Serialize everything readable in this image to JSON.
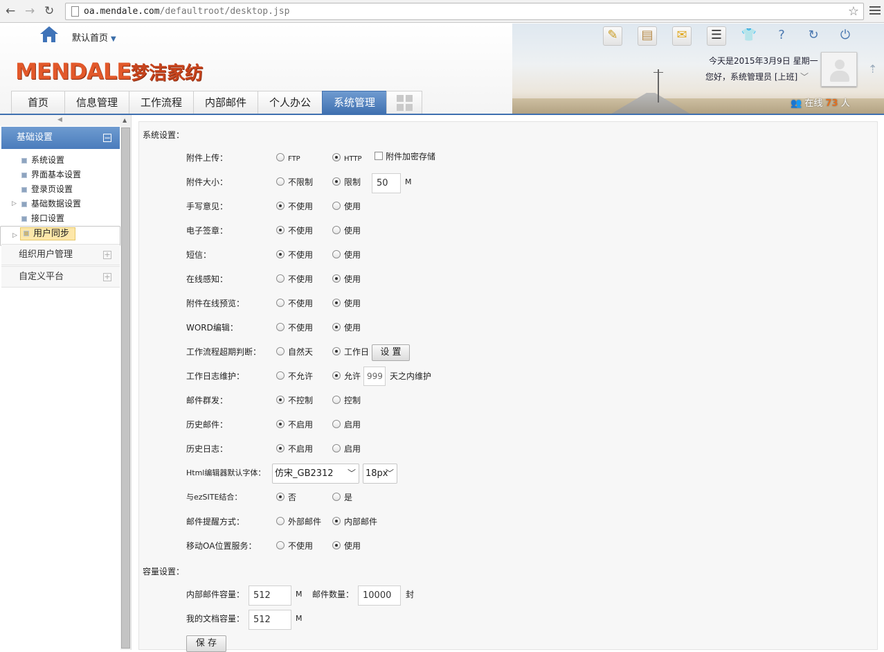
{
  "browser": {
    "url_domain": "oa.mendale.com",
    "url_path": "/defaultroot/desktop.jsp"
  },
  "header": {
    "home_label": "默认首页",
    "logo_text": "MENDALE",
    "logo_cn": "梦洁家纺",
    "date_text": "今天是2015年3月9日 星期一",
    "greeting": "您好，系统管理员 [上班]",
    "online_prefix": "在线",
    "online_count": "73",
    "online_suffix": "人",
    "toolbar_icons": [
      "edit-icon",
      "clipboard-icon",
      "mail-icon",
      "list-icon",
      "shirt-icon",
      "help-icon",
      "refresh-icon",
      "power-icon"
    ]
  },
  "tabs": [
    {
      "label": "首页"
    },
    {
      "label": "信息管理"
    },
    {
      "label": "工作流程"
    },
    {
      "label": "内部邮件"
    },
    {
      "label": "个人办公"
    },
    {
      "label": "系统管理",
      "active": true
    }
  ],
  "sidebar": {
    "section_active": "基础设置",
    "items": [
      {
        "label": "系统设置"
      },
      {
        "label": "界面基本设置"
      },
      {
        "label": "登录页设置"
      },
      {
        "label": "基础数据设置",
        "expandable": true
      },
      {
        "label": "接口设置"
      },
      {
        "label": "用户同步",
        "expandable": true,
        "selected": true
      }
    ],
    "sections": [
      {
        "label": "组织用户管理"
      },
      {
        "label": "自定义平台"
      }
    ]
  },
  "settings": {
    "title": "系统设置：",
    "attach_upload": {
      "label": "附件上传：",
      "opt1": "FTP",
      "opt2": "HTTP",
      "opt3": "附件加密存储"
    },
    "attach_size": {
      "label": "附件大小：",
      "opt1": "不限制",
      "opt2": "限制",
      "value": "50",
      "unit": "M"
    },
    "handwrite": {
      "label": "手写意见：",
      "opt1": "不使用",
      "opt2": "使用"
    },
    "esign": {
      "label": "电子签章：",
      "opt1": "不使用",
      "opt2": "使用"
    },
    "sms": {
      "label": "短信：",
      "opt1": "不使用",
      "opt2": "使用"
    },
    "online_sense": {
      "label": "在线感知：",
      "opt1": "不使用",
      "opt2": "使用"
    },
    "attach_preview": {
      "label": "附件在线预览：",
      "opt1": "不使用",
      "opt2": "使用"
    },
    "word_edit": {
      "label": "WORD编辑：",
      "opt1": "不使用",
      "opt2": "使用"
    },
    "workflow_overdue": {
      "label": "工作流程超期判断：",
      "opt1": "自然天",
      "opt2": "工作日",
      "button": "设 置"
    },
    "worklog": {
      "label": "工作日志维护：",
      "opt1": "不允许",
      "opt2": "允许",
      "value": "999",
      "suffix": "天之内维护"
    },
    "mass_mail": {
      "label": "邮件群发：",
      "opt1": "不控制",
      "opt2": "控制"
    },
    "history_mail": {
      "label": "历史邮件：",
      "opt1": "不启用",
      "opt2": "启用"
    },
    "history_log": {
      "label": "历史日志：",
      "opt1": "不启用",
      "opt2": "启用"
    },
    "html_font": {
      "label": "Html编辑器默认字体：",
      "font": "仿宋_GB2312",
      "size": "18px"
    },
    "ezsite": {
      "label": "与ezSITE结合：",
      "opt1": "否",
      "opt2": "是"
    },
    "mail_remind": {
      "label": "邮件提醒方式：",
      "opt1": "外部邮件",
      "opt2": "内部邮件"
    },
    "mobile_loc": {
      "label": "移动OA位置服务：",
      "opt1": "不使用",
      "opt2": "使用"
    }
  },
  "capacity": {
    "title": "容量设置：",
    "mail_cap_label": "内部邮件容量：",
    "mail_cap_value": "512",
    "mail_cap_unit": "M",
    "mail_count_label": "邮件数量：",
    "mail_count_value": "10000",
    "mail_count_unit": "封",
    "doc_cap_label": "我的文档容量：",
    "doc_cap_value": "512",
    "doc_cap_unit": "M",
    "save_button": "保 存"
  }
}
